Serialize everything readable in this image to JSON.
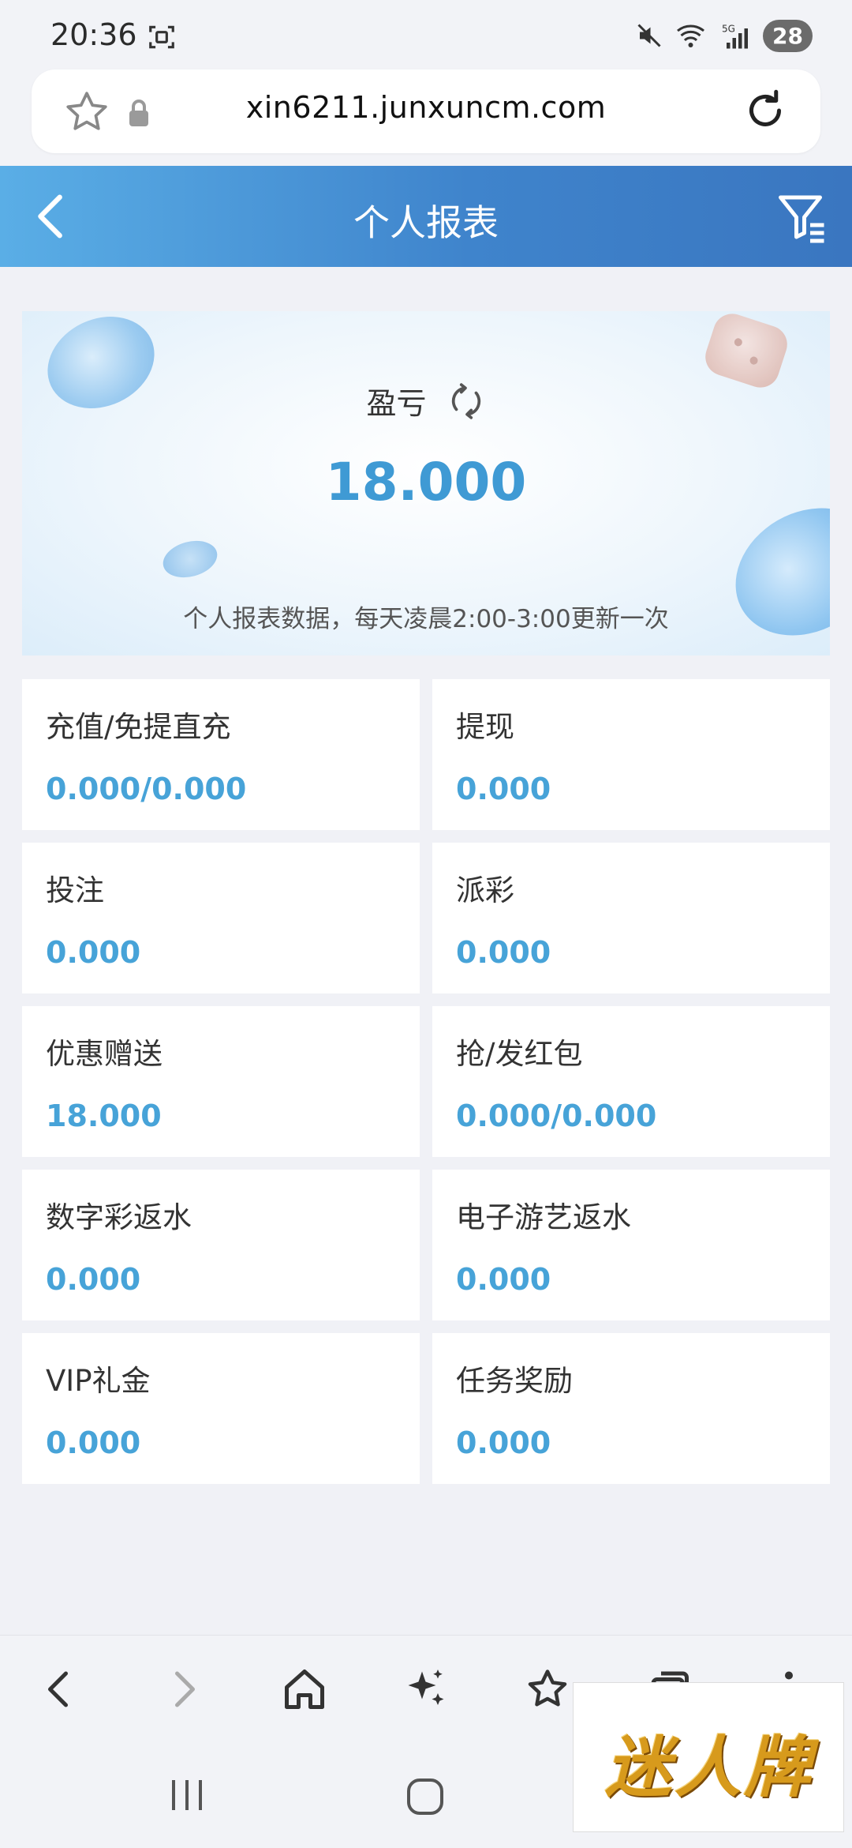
{
  "status_bar": {
    "time": "20:36",
    "battery": "28"
  },
  "browser": {
    "url": "xin6211.junxuncm.com"
  },
  "header": {
    "title": "个人报表"
  },
  "summary": {
    "label": "盈亏",
    "value": "18.000",
    "note": "个人报表数据，每天凌晨2:00-3:00更新一次"
  },
  "stats": [
    {
      "label": "充值/免提直充",
      "value": "0.000/0.000"
    },
    {
      "label": "提现",
      "value": "0.000"
    },
    {
      "label": "投注",
      "value": "0.000"
    },
    {
      "label": "派彩",
      "value": "0.000"
    },
    {
      "label": "优惠赠送",
      "value": "18.000"
    },
    {
      "label": "抢/发红包",
      "value": "0.000/0.000"
    },
    {
      "label": "数字彩返水",
      "value": "0.000"
    },
    {
      "label": "电子游艺返水",
      "value": "0.000"
    },
    {
      "label": "VIP礼金",
      "value": "0.000"
    },
    {
      "label": "任务奖励",
      "value": "0.000"
    }
  ],
  "watermark": {
    "text": "迷人牌"
  },
  "colors": {
    "accent": "#47a3d8",
    "header_start": "#5aaee6",
    "header_end": "#3a76c0"
  }
}
